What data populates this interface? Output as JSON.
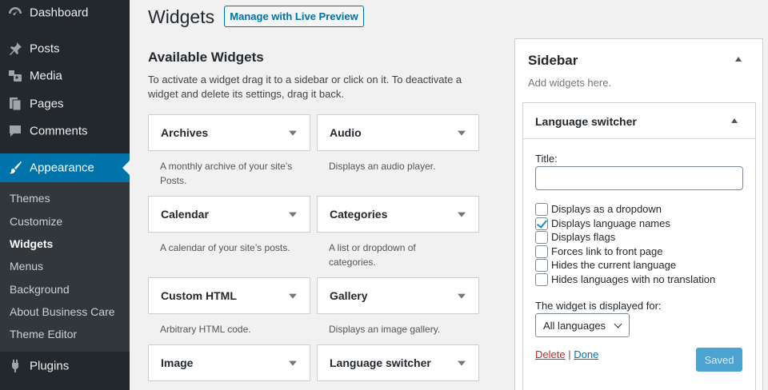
{
  "menu": {
    "dashboard": "Dashboard",
    "posts": "Posts",
    "media": "Media",
    "pages": "Pages",
    "comments": "Comments",
    "appearance": "Appearance",
    "plugins": "Plugins",
    "submenu": [
      "Themes",
      "Customize",
      "Widgets",
      "Menus",
      "Background",
      "About Business Care",
      "Theme Editor"
    ]
  },
  "header": {
    "title": "Widgets",
    "live_preview": "Manage with Live Preview"
  },
  "available": {
    "title": "Available Widgets",
    "description": "To activate a widget drag it to a sidebar or click on it. To deactivate a widget and delete its settings, drag it back.",
    "widgets": [
      {
        "title": "Archives",
        "desc": "A monthly archive of your site’s Posts."
      },
      {
        "title": "Audio",
        "desc": "Displays an audio player."
      },
      {
        "title": "Calendar",
        "desc": "A calendar of your site’s posts."
      },
      {
        "title": "Categories",
        "desc": "A list or dropdown of categories."
      },
      {
        "title": "Custom HTML",
        "desc": "Arbitrary HTML code."
      },
      {
        "title": "Gallery",
        "desc": "Displays an image gallery."
      },
      {
        "title": "Image",
        "desc": ""
      },
      {
        "title": "Language switcher",
        "desc": ""
      }
    ]
  },
  "sidebar_area": {
    "title": "Sidebar",
    "hint": "Add widgets here.",
    "widget": {
      "title": "Language switcher",
      "title_label": "Title:",
      "title_value": "",
      "options": [
        {
          "label": "Displays as a dropdown",
          "checked": false
        },
        {
          "label": "Displays language names",
          "checked": true
        },
        {
          "label": "Displays flags",
          "checked": false
        },
        {
          "label": "Forces link to front page",
          "checked": false
        },
        {
          "label": "Hides the current language",
          "checked": false
        },
        {
          "label": "Hides languages with no translation",
          "checked": false
        }
      ],
      "display_label": "The widget is displayed for:",
      "display_value": "All languages",
      "delete": "Delete",
      "separator": "|",
      "done": "Done",
      "saved": "Saved"
    }
  },
  "colors": {
    "menu_bg": "#23282d",
    "submenu_bg": "#32373c",
    "accent": "#0073aa",
    "delete": "#b32d2e"
  }
}
